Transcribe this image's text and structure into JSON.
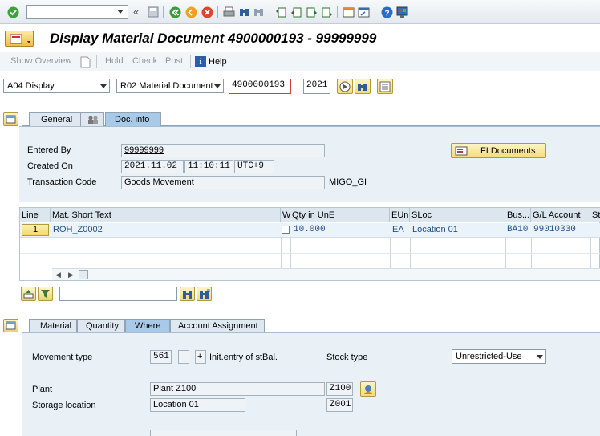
{
  "toolbar": {
    "command_field_value": "",
    "icons": [
      "enter-icon",
      "back-double-icon",
      "save-icon",
      "back-icon",
      "exit-icon",
      "cancel-icon",
      "print-icon",
      "find-icon",
      "find-next-icon",
      "first-page-icon",
      "prev-page-icon",
      "next-page-icon",
      "last-page-icon",
      "new-session-icon",
      "shortcut-icon",
      "help-icon",
      "customize-icon"
    ]
  },
  "title": {
    "text": "Display Material Document 4900000193 - 99999999"
  },
  "app_toolbar": {
    "show_overview": "Show Overview",
    "hold": "Hold",
    "check": "Check",
    "post": "Post",
    "help": "Help"
  },
  "header": {
    "action_select": "A04 Display",
    "reference_select": "R02 Material Document",
    "doc_number": "4900000193",
    "year": "2021"
  },
  "header_tabs": {
    "general": "General",
    "doc_info": "Doc. info"
  },
  "doc_info": {
    "entered_by_label": "Entered By",
    "entered_by_value": "99999999",
    "created_on_label": "Created On",
    "created_date": "2021.11.02",
    "created_time": "11:10:11",
    "created_tz": "UTC+9",
    "tcode_label": "Transaction Code",
    "tcode_value": "Goods Movement",
    "tcode_code": "MIGO_GI",
    "fi_documents": "FI Documents"
  },
  "items_table": {
    "columns": [
      "Line",
      "Mat. Short Text",
      "W",
      "Qty in UnE",
      "EUn",
      "SLoc",
      "Bus...",
      "G/L Account",
      "St"
    ],
    "rows": [
      {
        "line": "1",
        "mat_text": "ROH_Z0002",
        "qty": "10.000",
        "eun": "EA",
        "sloc": "Location 01",
        "bus": "BA10",
        "gl": "99010330"
      }
    ]
  },
  "detail_tabs": {
    "material": "Material",
    "quantity": "Quantity",
    "where": "Where",
    "account_assignment": "Account Assignment"
  },
  "where": {
    "movement_type_label": "Movement type",
    "movement_type_value": "561",
    "movement_special": "",
    "plus": "+",
    "movement_text": "Init.entry of stBal.",
    "stock_type_label": "Stock type",
    "stock_type_value": "Unrestricted-Use",
    "plant_label": "Plant",
    "plant_value": "Plant Z100",
    "plant_code": "Z100",
    "sloc_label": "Storage location",
    "sloc_value": "Location 01",
    "sloc_code": "Z001"
  }
}
